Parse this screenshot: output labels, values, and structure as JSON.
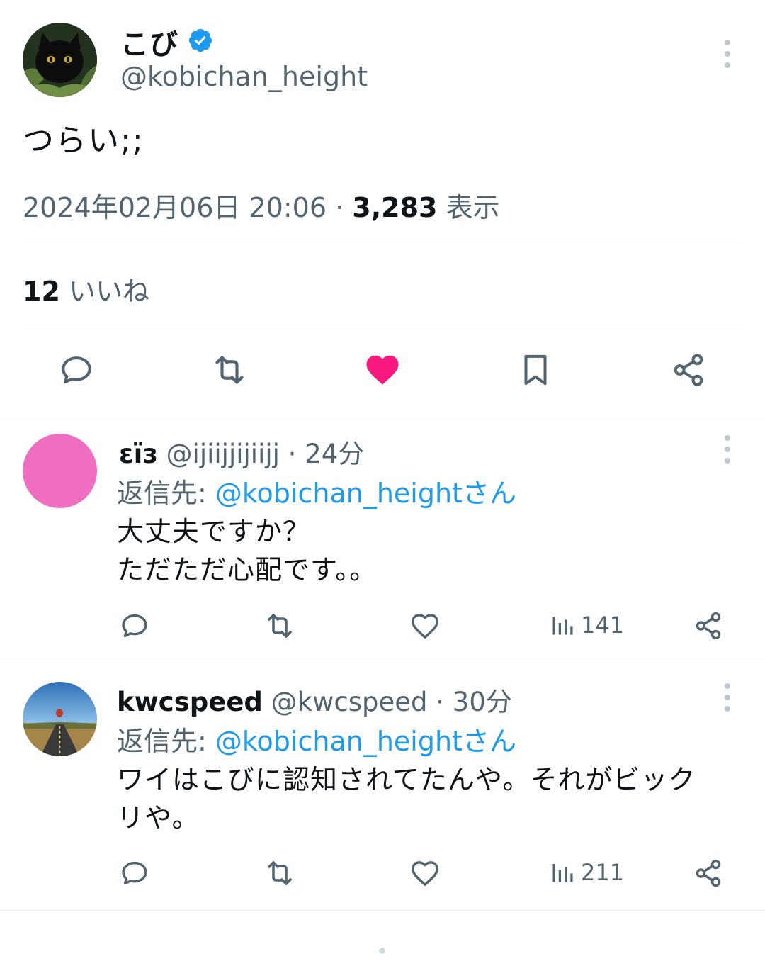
{
  "main_tweet": {
    "name": "こび",
    "handle": "@kobichan_height",
    "text": "つらい;;",
    "date": "2024年02月06日 20:06",
    "separator": "·",
    "views": "3,283",
    "views_label": "表示",
    "likes_count": "12",
    "likes_label": "いいね"
  },
  "replies": [
    {
      "name": "εïз",
      "handle": "@ijiijjijiijj",
      "time": "24分",
      "reply_prefix": "返信先: ",
      "reply_to": "@kobichan_heightさん",
      "line1": "大丈夫ですか？",
      "line2": "ただただ心配です。。",
      "views": "141",
      "avatar_color": "#f06ec2"
    },
    {
      "name": "kwcspeed",
      "handle": "@kwcspeed",
      "time": "30分",
      "reply_prefix": "返信先: ",
      "reply_to": "@kobichan_heightさん",
      "line1": "ワイはこびに認知されてたんや。それがビック",
      "line2": "リや。",
      "views": "211"
    }
  ],
  "colors": {
    "accent": "#1d9bf0",
    "like_active": "#f91880",
    "muted": "#536471",
    "text": "#0f1419"
  }
}
